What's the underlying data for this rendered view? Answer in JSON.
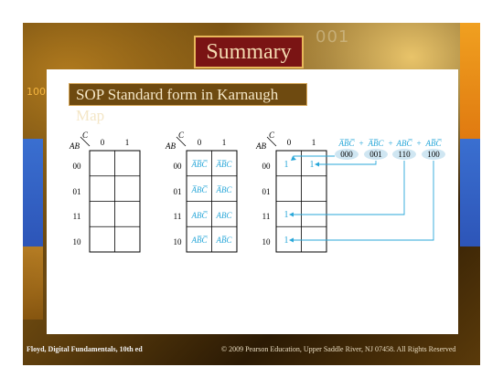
{
  "slide": {
    "title": "Summary",
    "subtitle": "SOP Standard form in Karnaugh Map",
    "footer_left": "Floyd, Digital Fundamentals, 10th ed",
    "footer_right": "© 2009 Pearson Education, Upper Saddle River, NJ 07458. All Rights Reserved",
    "bg_number_left": "100",
    "bg_number_top": "001"
  },
  "colors": {
    "title_bg": "#7a1414",
    "title_text": "#f3d9b0",
    "subtitle_bg": "#6e4a10",
    "accent_cyan": "#29a7d9",
    "term_bubble": "#cfe6f2"
  },
  "kmap": {
    "var_ab": "AB",
    "var_c": "C",
    "col_headers": [
      "0",
      "1"
    ],
    "row_headers": [
      "00",
      "01",
      "11",
      "10"
    ]
  },
  "map2_cells": [
    [
      "A̅B̅C̅",
      "A̅B̅C"
    ],
    [
      "A̅BC̅",
      "A̅BC"
    ],
    [
      "ABC̅",
      "ABC"
    ],
    [
      "AB̅C̅",
      "AB̅C"
    ]
  ],
  "map3_ones": [
    {
      "label": "1"
    },
    {
      "label": "1"
    },
    {
      "label": "1"
    },
    {
      "label": "1"
    }
  ],
  "expression": {
    "terms": [
      "A̅B̅C̅",
      "A̅B̅C",
      "ABC̅",
      "AB̅C̅"
    ],
    "plus": "+",
    "binary": [
      "000",
      "001",
      "110",
      "100"
    ]
  }
}
